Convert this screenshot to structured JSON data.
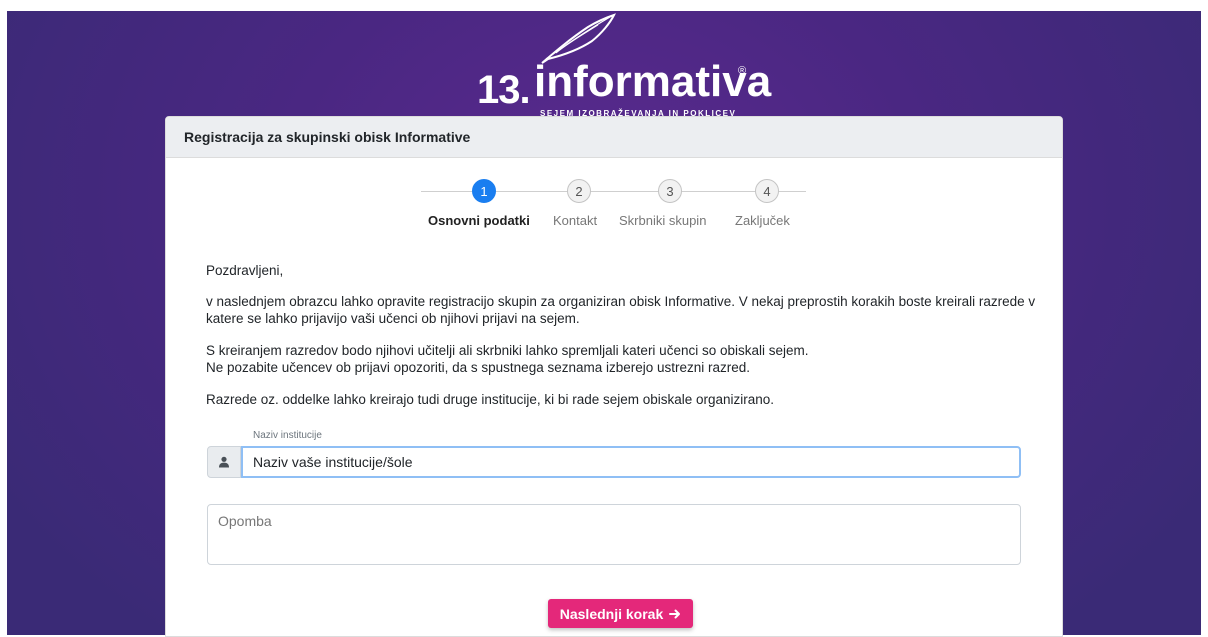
{
  "logo": {
    "number": "13.",
    "word": "informativa",
    "registered": "®",
    "subtitle": "SEJEM IZOBRAŽEVANJA IN POKLICEV"
  },
  "card": {
    "title": "Registracija za skupinski obisk Informative"
  },
  "steps": [
    {
      "number": "1",
      "label": "Osnovni podatki",
      "active": true
    },
    {
      "number": "2",
      "label": "Kontakt",
      "active": false
    },
    {
      "number": "3",
      "label": "Skrbniki skupin",
      "active": false
    },
    {
      "number": "4",
      "label": "Zaključek",
      "active": false
    }
  ],
  "intro": {
    "greeting": "Pozdravljeni,",
    "p1": "v naslednjem obrazcu lahko opravite registracijo skupin za organiziran obisk Informative. V nekaj preprostih korakih boste kreirali razrede v katere se lahko prijavijo vaši učenci ob njihovi prijavi na sejem.",
    "p2a": "S kreiranjem razredov bodo njihovi učitelji ali skrbniki lahko spremljali kateri učenci so obiskali sejem.",
    "p2b": "Ne pozabite učencev ob prijavi opozoriti, da s spustnega seznama izberejo ustrezni razred.",
    "p3": "Razrede oz. oddelke lahko kreirajo tudi druge institucije, ki bi rade sejem obiskale organizirano."
  },
  "form": {
    "institution_label": "Naziv institucije",
    "institution_value": "Naziv vaše institucije/šole",
    "note_placeholder": "Opomba",
    "next_button": "Naslednji korak",
    "next_icon": "arrow-right-icon"
  },
  "colors": {
    "accent": "#1a7ef0",
    "button": "#e4287a",
    "background": "#4a2782"
  }
}
